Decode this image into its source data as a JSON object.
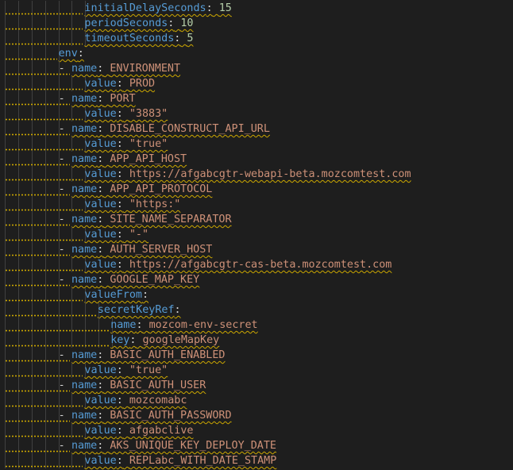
{
  "theme": {
    "background": "#1e1e1e",
    "key_color": "#569cd6",
    "string_color": "#ce9178",
    "number_color": "#b5cea8",
    "punctuation_color": "#d4d4d4",
    "warning_squiggle_color": "#cca700"
  },
  "lines": [
    {
      "indent": 7,
      "key": "initialDelaySeconds",
      "value": "15",
      "value_type": "number"
    },
    {
      "indent": 7,
      "key": "periodSeconds",
      "value": "10",
      "value_type": "number"
    },
    {
      "indent": 7,
      "key": "timeoutSeconds",
      "value": "5",
      "value_type": "number"
    },
    {
      "indent": 5,
      "key": "env",
      "value": "",
      "value_type": "none"
    },
    {
      "indent": 6,
      "dash": true,
      "key": "name",
      "value": "ENVIRONMENT",
      "value_type": "string"
    },
    {
      "indent": 7,
      "key": "value",
      "value": "PROD",
      "value_type": "string"
    },
    {
      "indent": 6,
      "dash": true,
      "key": "name",
      "value": "PORT",
      "value_type": "string"
    },
    {
      "indent": 7,
      "key": "value",
      "value": "\"3883\"",
      "value_type": "string"
    },
    {
      "indent": 6,
      "dash": true,
      "key": "name",
      "value": "DISABLE_CONSTRUCT_API_URL",
      "value_type": "string"
    },
    {
      "indent": 7,
      "key": "value",
      "value": "\"true\"",
      "value_type": "string"
    },
    {
      "indent": 6,
      "dash": true,
      "key": "name",
      "value": "APP_API_HOST",
      "value_type": "string"
    },
    {
      "indent": 7,
      "key": "value",
      "value": "https://afgabcgtr-webapi-beta.mozcomtest.com",
      "value_type": "string"
    },
    {
      "indent": 6,
      "dash": true,
      "key": "name",
      "value": "APP_API_PROTOCOL",
      "value_type": "string"
    },
    {
      "indent": 7,
      "key": "value",
      "value": "\"https:\"",
      "value_type": "string"
    },
    {
      "indent": 6,
      "dash": true,
      "key": "name",
      "value": "SITE_NAME_SEPARATOR",
      "value_type": "string"
    },
    {
      "indent": 7,
      "key": "value",
      "value": "\"-\"",
      "value_type": "string"
    },
    {
      "indent": 6,
      "dash": true,
      "key": "name",
      "value": "AUTH_SERVER_HOST",
      "value_type": "string"
    },
    {
      "indent": 7,
      "key": "value",
      "value": "https://afgabcgtr-cas-beta.mozcomtest.com",
      "value_type": "string"
    },
    {
      "indent": 6,
      "dash": true,
      "key": "name",
      "value": "GOOGLE_MAP_KEY",
      "value_type": "string"
    },
    {
      "indent": 7,
      "key": "valueFrom",
      "value": "",
      "value_type": "none"
    },
    {
      "indent": 8,
      "key": "secretKeyRef",
      "value": "",
      "value_type": "none"
    },
    {
      "indent": 9,
      "key": "name",
      "value": "mozcom-env-secret",
      "value_type": "string"
    },
    {
      "indent": 9,
      "key": "key",
      "value": "googleMapKey",
      "value_type": "string"
    },
    {
      "indent": 6,
      "dash": true,
      "key": "name",
      "value": "BASIC_AUTH_ENABLED",
      "value_type": "string"
    },
    {
      "indent": 7,
      "key": "value",
      "value": "\"true\"",
      "value_type": "string"
    },
    {
      "indent": 6,
      "dash": true,
      "key": "name",
      "value": "BASIC_AUTH_USER",
      "value_type": "string"
    },
    {
      "indent": 7,
      "key": "value",
      "value": "mozcomabc",
      "value_type": "string"
    },
    {
      "indent": 6,
      "dash": true,
      "key": "name",
      "value": "BASIC_AUTH_PASSWORD",
      "value_type": "string"
    },
    {
      "indent": 7,
      "key": "value",
      "value": "afgabclive",
      "value_type": "string"
    },
    {
      "indent": 6,
      "dash": true,
      "key": "name",
      "value": "AKS_UNIQUE_KEY_DEPLOY_DATE",
      "value_type": "string"
    },
    {
      "indent": 7,
      "key": "value",
      "value": "REPLabc_WITH_DATE_STAMP",
      "value_type": "string"
    }
  ]
}
